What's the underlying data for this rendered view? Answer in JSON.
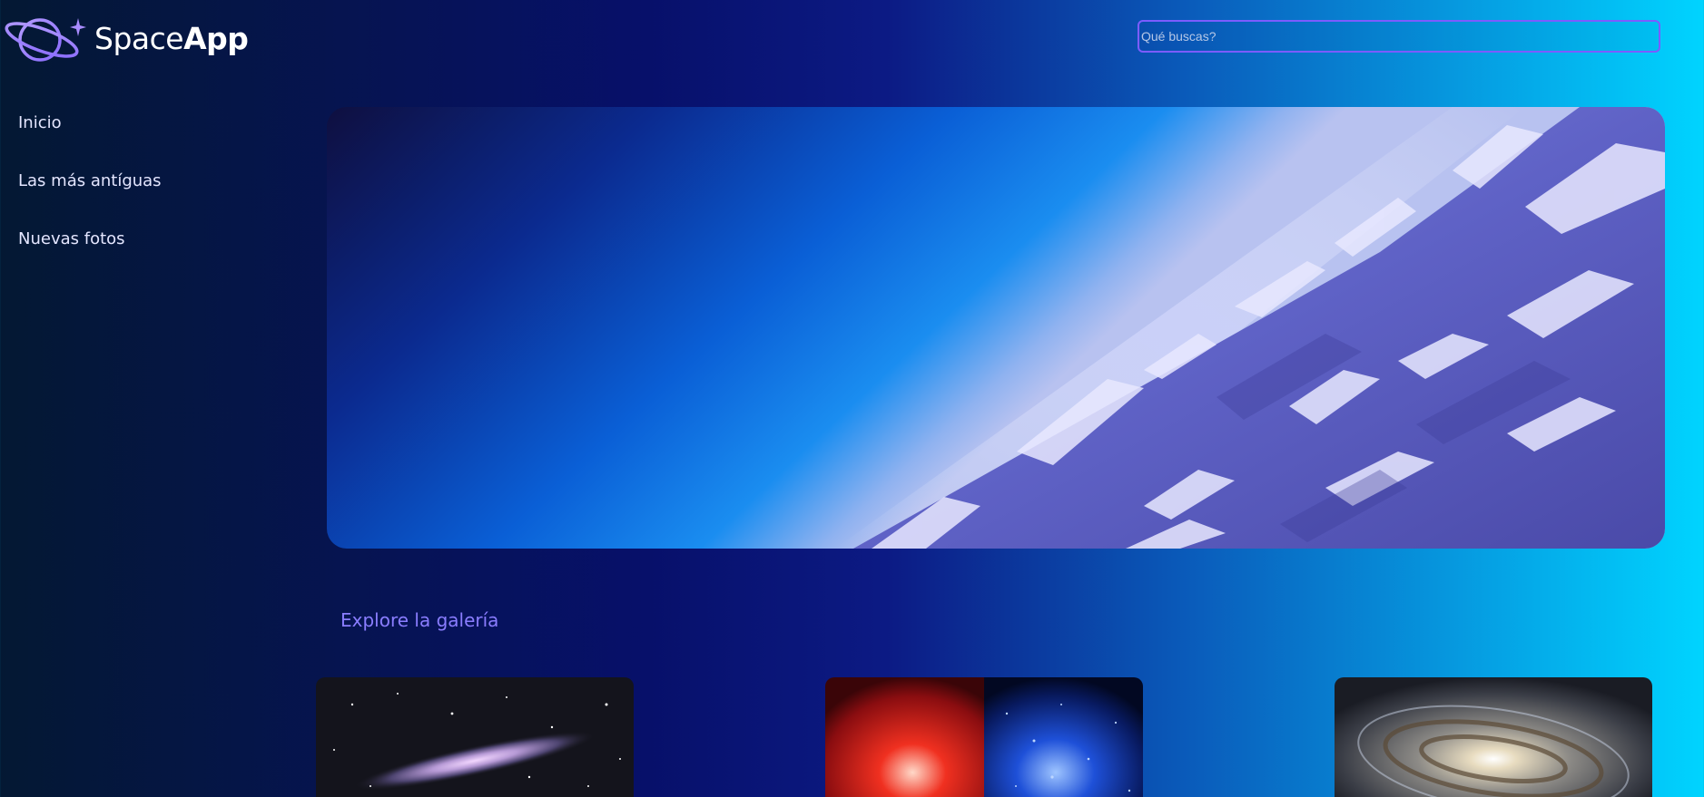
{
  "header": {
    "logo_text_light": "Space",
    "logo_text_bold": "App",
    "logo_icon": "planet-ring-icon",
    "search_placeholder": "Qué buscas?",
    "search_value": ""
  },
  "sidebar": {
    "items": [
      {
        "label": "Inicio"
      },
      {
        "label": "Las más antíguas"
      },
      {
        "label": "Nuevas fotos"
      }
    ]
  },
  "hero": {
    "image": "earth-horizon-from-space"
  },
  "gallery": {
    "title": "Explore la galería",
    "cards": [
      {
        "image": "galaxy-edge-on-starfield"
      },
      {
        "image": "red-and-blue-star-fields"
      },
      {
        "image": "spiral-galaxy-closeup"
      }
    ]
  },
  "colors": {
    "accent": "#7c5cff",
    "gallery_title": "#8a7dff",
    "background_start": "#041833",
    "background_mid": "#07106a",
    "background_end": "#00d4ff"
  }
}
